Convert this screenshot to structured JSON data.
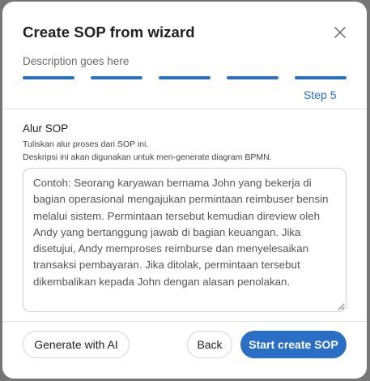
{
  "dialog": {
    "title": "Create SOP from wizard",
    "subtitle": "Description goes here",
    "step_label": "Step 5",
    "steps_total": 5,
    "steps_completed": 5,
    "accent_color": "#2a6ec6"
  },
  "form": {
    "label": "Alur SOP",
    "help_line_1": "Tuliskan alur proses dari SOP ini.",
    "help_line_2": "Deskripsi ini akan digunakan untuk men-generate diagram BPMN.",
    "textarea_placeholder": "Contoh: Seorang karyawan bernama John yang bekerja di bagian operasional mengajukan permintaan reimbuser bensin melalui sistem. Permintaan tersebut kemudian direview oleh Andy yang bertanggung jawab di bagian keuangan. Jika disetujui, Andy memproses reimburse dan menyelesaikan transaksi pembayaran. Jika ditolak, permintaan tersebut dikembalikan kepada John dengan alasan penolakan.",
    "textarea_value": ""
  },
  "footer": {
    "generate_label": "Generate with AI",
    "back_label": "Back",
    "start_label": "Start create SOP"
  },
  "icons": {
    "close": "close-icon",
    "resize": "resize-grip-icon"
  }
}
